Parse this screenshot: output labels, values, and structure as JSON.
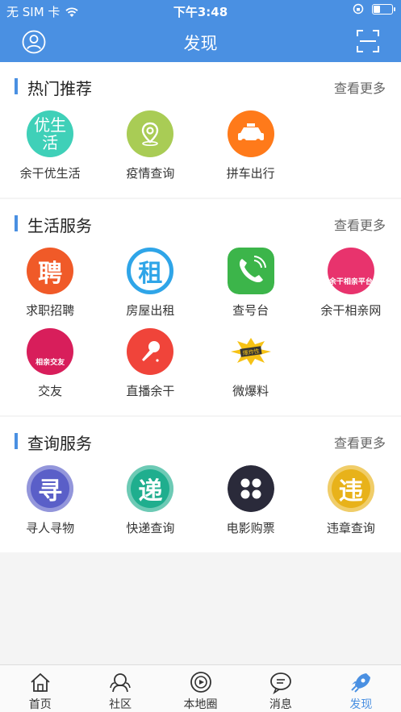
{
  "status": {
    "carrier": "无 SIM 卡",
    "time": "下午3:48",
    "battery_level": 0.4
  },
  "nav": {
    "title": "发现"
  },
  "sections": [
    {
      "title": "热门推荐",
      "more": "查看更多",
      "items": [
        {
          "label": "余干优生活",
          "icon": "youshenghuo-icon",
          "icon_text": "优生活",
          "color": "#3fd0b8"
        },
        {
          "label": "疫情查询",
          "icon": "location-pin-icon",
          "color": "#a9cc55"
        },
        {
          "label": "拼车出行",
          "icon": "taxi-icon",
          "color": "#ff7a1a"
        }
      ]
    },
    {
      "title": "生活服务",
      "more": "查看更多",
      "items": [
        {
          "label": "求职招聘",
          "icon": "pin-job-icon",
          "icon_text": "聘",
          "color": "#f05a28"
        },
        {
          "label": "房屋出租",
          "icon": "rent-icon",
          "icon_text": "租",
          "color": "#2fa5e8"
        },
        {
          "label": "查号台",
          "icon": "phone-icon",
          "color": "#3cb54a"
        },
        {
          "label": "余干相亲网",
          "icon": "dating-site-icon",
          "icon_text": "余干相亲平台",
          "color": "#e8336d"
        },
        {
          "label": "交友",
          "icon": "friends-icon",
          "icon_text": "相亲交友",
          "color": "#d81e5b"
        },
        {
          "label": "直播余干",
          "icon": "microphone-icon",
          "color": "#f0443a"
        },
        {
          "label": "微爆料",
          "icon": "breaking-news-icon",
          "icon_text": "爆炸性",
          "color": "#f6c215"
        }
      ]
    },
    {
      "title": "查询服务",
      "more": "查看更多",
      "items": [
        {
          "label": "寻人寻物",
          "icon": "search-person-icon",
          "icon_text": "寻",
          "color": "#5a5fc8"
        },
        {
          "label": "快递查询",
          "icon": "express-icon",
          "icon_text": "递",
          "color": "#1fae8e"
        },
        {
          "label": "电影购票",
          "icon": "film-reel-icon",
          "color": "#2a2a3a"
        },
        {
          "label": "违章查询",
          "icon": "violation-icon",
          "icon_text": "违",
          "color": "#e8b21a"
        }
      ]
    }
  ],
  "tabbar": [
    {
      "label": "首页",
      "icon": "home-icon",
      "active": false
    },
    {
      "label": "社区",
      "icon": "community-icon",
      "active": false
    },
    {
      "label": "本地圈",
      "icon": "local-circle-icon",
      "active": false
    },
    {
      "label": "消息",
      "icon": "message-icon",
      "active": false
    },
    {
      "label": "发现",
      "icon": "rocket-icon",
      "active": true
    }
  ]
}
